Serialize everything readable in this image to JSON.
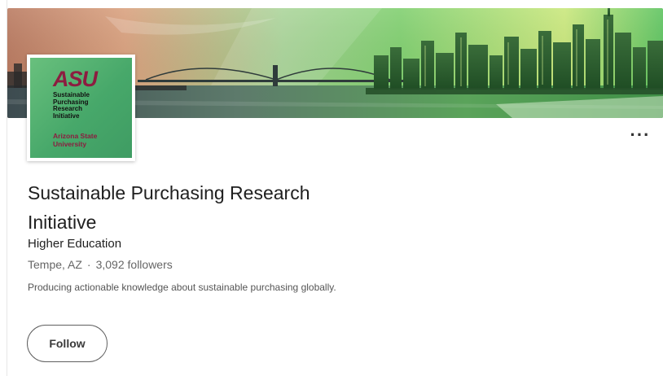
{
  "logo": {
    "mark": "ASU",
    "initiative_lines": "Sustainable\nPurchasing\nResearch\nInitiative",
    "university_lines": "Arizona State\nUniversity",
    "colors": {
      "background": "#4fb071",
      "maroon": "#8c1d40"
    }
  },
  "banner": {
    "description_icon": "city-skyline-banner",
    "colors": {
      "left": "#d98d6a",
      "right": "#4cc064",
      "accent": "#c6e86a"
    }
  },
  "menu": {
    "more_label": "···"
  },
  "organization": {
    "name": "Sustainable Purchasing Research Initiative",
    "industry": "Higher Education",
    "location": "Tempe, AZ",
    "separator": "·",
    "followers": "3,092 followers",
    "tagline": "Producing actionable knowledge about sustainable purchasing globally."
  },
  "actions": {
    "follow_label": "Follow"
  }
}
